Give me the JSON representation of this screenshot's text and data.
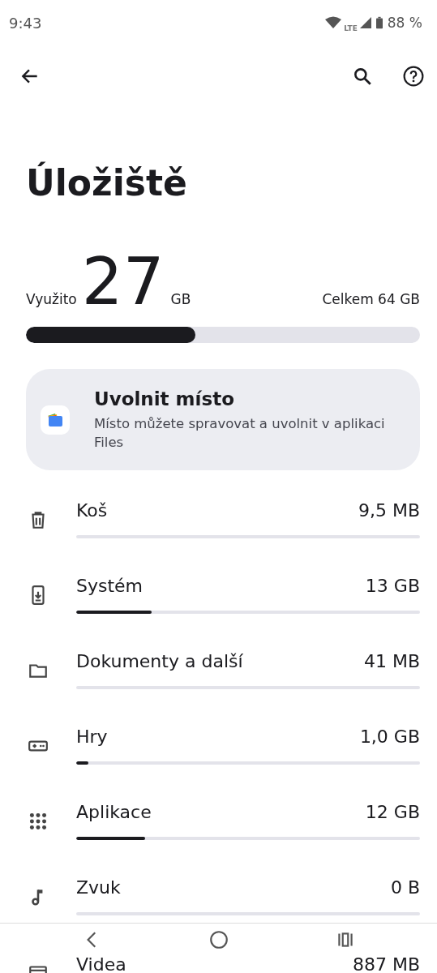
{
  "status_bar": {
    "time": "9:43",
    "network": "LTE",
    "battery": "88 %"
  },
  "title": "Úložiště",
  "usage": {
    "used_label": "Využito",
    "used_value": "27",
    "used_unit": "GB",
    "total": "Celkem 64 GB",
    "level": 0.43
  },
  "free_up_card": {
    "title": "Uvolnit místo",
    "description": "Místo můžete spravovat a uvolnit v aplikaci Files"
  },
  "categories": [
    {
      "kind": "trash",
      "name": "Koš",
      "size": "9,5 MB",
      "level": 0
    },
    {
      "kind": "system",
      "name": "Systém",
      "size": "13 GB",
      "level": 0.22
    },
    {
      "kind": "documents",
      "name": "Dokumenty a další",
      "size": "41 MB",
      "level": 0
    },
    {
      "kind": "games",
      "name": "Hry",
      "size": "1,0 GB",
      "level": 0.035
    },
    {
      "kind": "apps",
      "name": "Aplikace",
      "size": "12 GB",
      "level": 0.2
    },
    {
      "kind": "audio",
      "name": "Zvuk",
      "size": "0 B",
      "level": 0
    },
    {
      "kind": "video",
      "name": "Videa",
      "size": "887 MB"
    }
  ]
}
